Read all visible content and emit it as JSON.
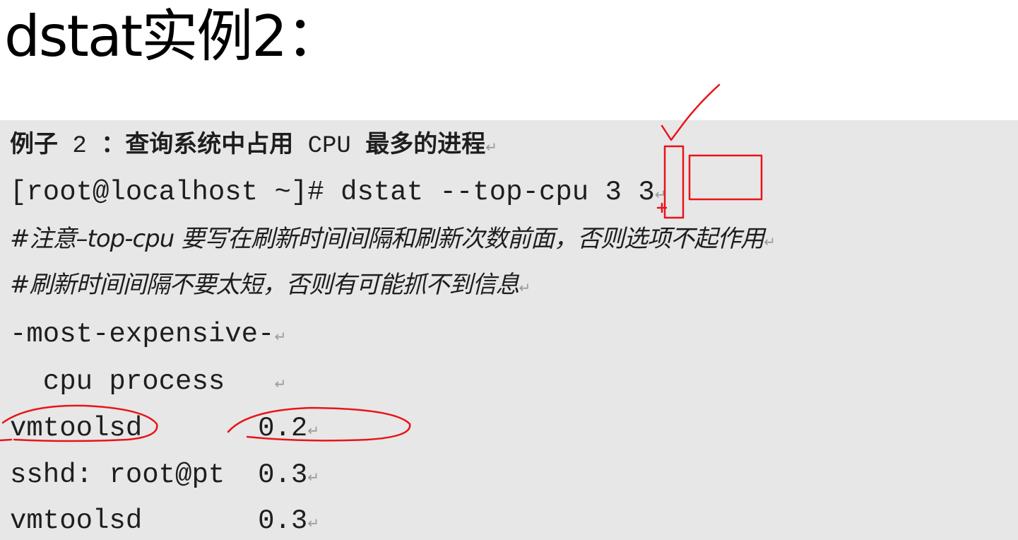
{
  "title": "dstat实例2：",
  "doc": {
    "heading": {
      "prefix": "例子",
      "num": " 2 ",
      "middle": "：查询系统中占用",
      "cpu": " CPU ",
      "suffix": "最多的进程"
    },
    "command": "[root@localhost ~]# dstat --top-cpu 3 3",
    "comment1": "#注意–top-cpu 要写在刷新时间间隔和刷新次数前面，否则选项不起作用",
    "comment2": "#刷新时间间隔不要太短，否则有可能抓不到信息",
    "output_header1": "-most-expensive-",
    "output_header2": "  cpu process   ",
    "rows": [
      {
        "name": "vmtoolsd     ",
        "value": "0.2"
      },
      {
        "name": "sshd: root@pt",
        "value": "0.3"
      },
      {
        "name": "vmtoolsd     ",
        "value": "0.3"
      }
    ],
    "return_mark": "↵"
  },
  "annotation_color": "#e8141a"
}
